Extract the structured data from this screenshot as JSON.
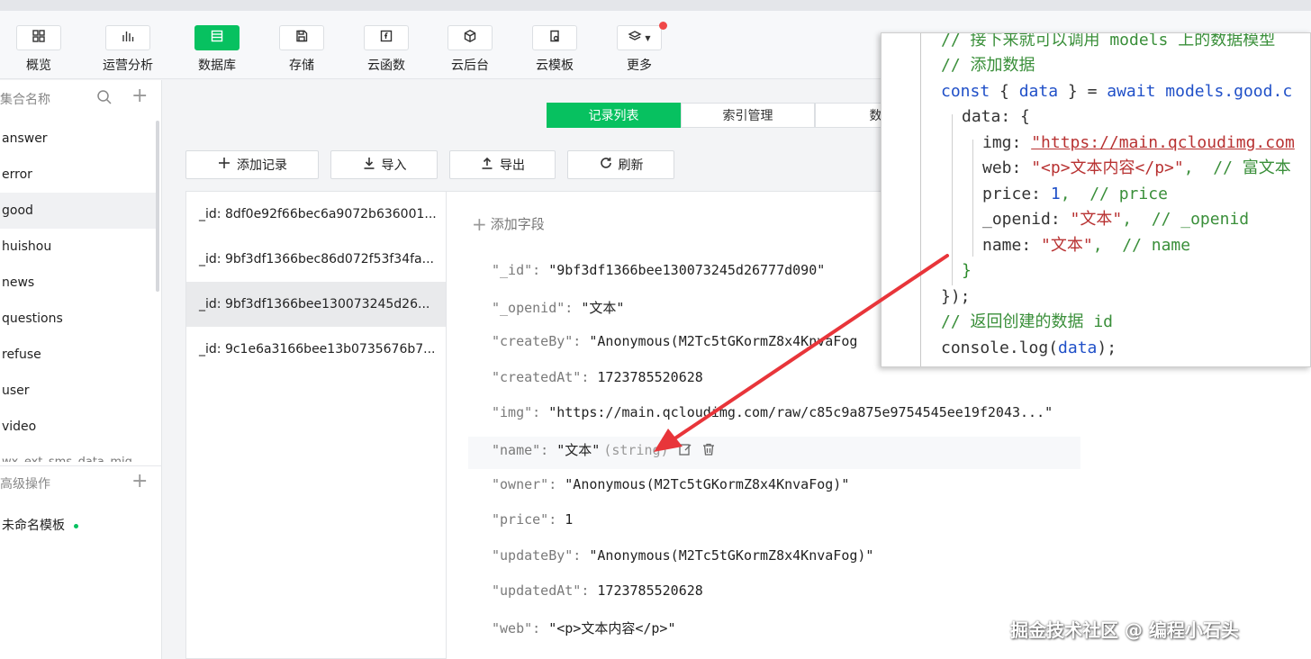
{
  "toolbar": {
    "items": [
      {
        "label": "概览",
        "icon": "grid-icon"
      },
      {
        "label": "运营分析",
        "icon": "bar-chart-icon"
      },
      {
        "label": "数据库",
        "icon": "database-icon",
        "active": true
      },
      {
        "label": "存储",
        "icon": "save-icon"
      },
      {
        "label": "云函数",
        "icon": "function-icon"
      },
      {
        "label": "云后台",
        "icon": "cube-icon"
      },
      {
        "label": "云模板",
        "icon": "template-icon"
      },
      {
        "label": "更多",
        "icon": "layers-icon"
      }
    ],
    "accent": "#07c160"
  },
  "sidebar": {
    "header": "集合名称",
    "collections": [
      "answer",
      "error",
      "good",
      "huishou",
      "news",
      "questions",
      "refuse",
      "user",
      "video"
    ],
    "selected": "good",
    "cut_item": "wx_ext_sms_data_mig",
    "advanced_header": "高级操作",
    "template_item": "未命名模板"
  },
  "tabs": [
    "记录列表",
    "索引管理",
    "数据"
  ],
  "actions": {
    "add_record": "添加记录",
    "import": "导入",
    "export": "导出",
    "refresh": "刷新"
  },
  "records": [
    "_id: 8df0e92f66bec6a9072b636001...",
    "_id: 9bf3df1366bec86d072f53f34fa...",
    "_id: 9bf3df1366bee130073245d26...",
    "_id: 9c1e6a3166bee13b0735676b7..."
  ],
  "detail": {
    "add_field": "添加字段",
    "fields": [
      {
        "key": "\"_id\":",
        "value": "\"9bf3df1366bee130073245d26777d090\""
      },
      {
        "key": "\"_openid\":",
        "value": "\"文本\""
      },
      {
        "key": "\"createBy\":",
        "value": "\"Anonymous(M2Tc5tGKormZ8x4KnvaFog"
      },
      {
        "key": "\"createdAt\":",
        "value": "1723785520628"
      },
      {
        "key": "\"img\":",
        "value": "\"https://main.qcloudimg.com/raw/c85c9a875e9754545ee19f2043...\""
      },
      {
        "key": "\"name\":",
        "value": "\"文本\"",
        "type": "(string)"
      },
      {
        "key": "\"owner\":",
        "value": "\"Anonymous(M2Tc5tGKormZ8x4KnvaFog)\""
      },
      {
        "key": "\"price\":",
        "value": "1"
      },
      {
        "key": "\"updateBy\":",
        "value": "\"Anonymous(M2Tc5tGKormZ8x4KnvaFog)\""
      },
      {
        "key": "\"updatedAt\":",
        "value": "1723785520628"
      },
      {
        "key": "\"web\":",
        "value": "\"<p>文本内容</p>\""
      }
    ]
  },
  "code": {
    "line1": "// 接下来就可以调用 models 上的数据模型",
    "line2": "// 添加数据",
    "line3_kw": "const",
    "line3_a": " { ",
    "line3_var": "data",
    "line3_b": " } = ",
    "line3_await": "await",
    "line3_c": " models.good.c",
    "line4": "data: {",
    "line5_key": "img: ",
    "line5_val": "\"https://main.qcloudimg.com",
    "line6_key": "web: ",
    "line6_val": "\"<p>文本内容</p>\"",
    "line6_cm": ",  // 富文本",
    "line7_key": "price: ",
    "line7_val": "1",
    "line7_cm": ",  // price",
    "line8_key": "_openid: ",
    "line8_val": "\"文本\"",
    "line8_cm": ",  // _openid",
    "line9_key": "name: ",
    "line9_val": "\"文本\"",
    "line9_cm": ",  // name",
    "line10": "}",
    "line11": "});",
    "line12": "// 返回创建的数据 id",
    "line13_a": "console.log(",
    "line13_var": "data",
    "line13_b": ");"
  },
  "watermark": "掘金技术社区 @ 编程小石头"
}
